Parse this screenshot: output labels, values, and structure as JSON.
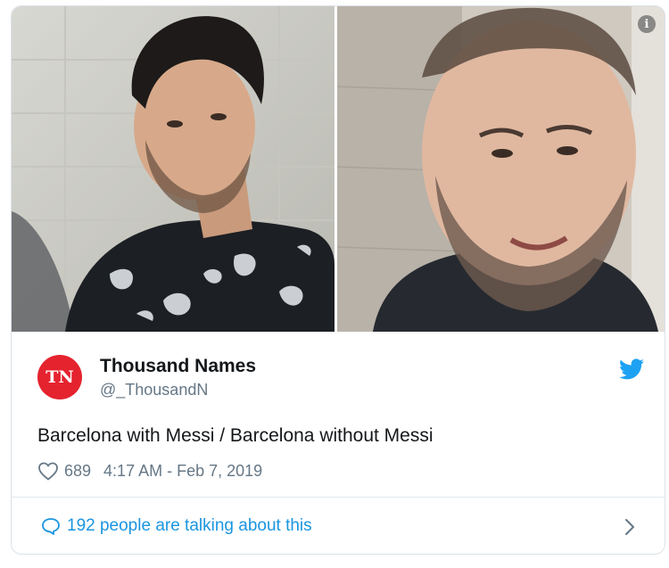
{
  "tweet": {
    "avatar_initials": "TN",
    "avatar_color": "#e5232f",
    "display_name": "Thousand Names",
    "handle": "@_ThousandN",
    "text": "Barcelona with Messi / Barcelona without Messi",
    "likes": "689",
    "timestamp": "4:17 AM - Feb 7, 2019",
    "talking": "192 people are talking about this",
    "accent_color": "#1b95e0"
  },
  "media": {
    "left_photo": "photo-man-floral-shirt",
    "right_photo": "photo-man-smiling",
    "info_glyph": "i"
  },
  "icons": [
    "info-icon",
    "twitter-bird-icon",
    "heart-icon",
    "speech-bubble-icon",
    "chevron-right-icon"
  ]
}
